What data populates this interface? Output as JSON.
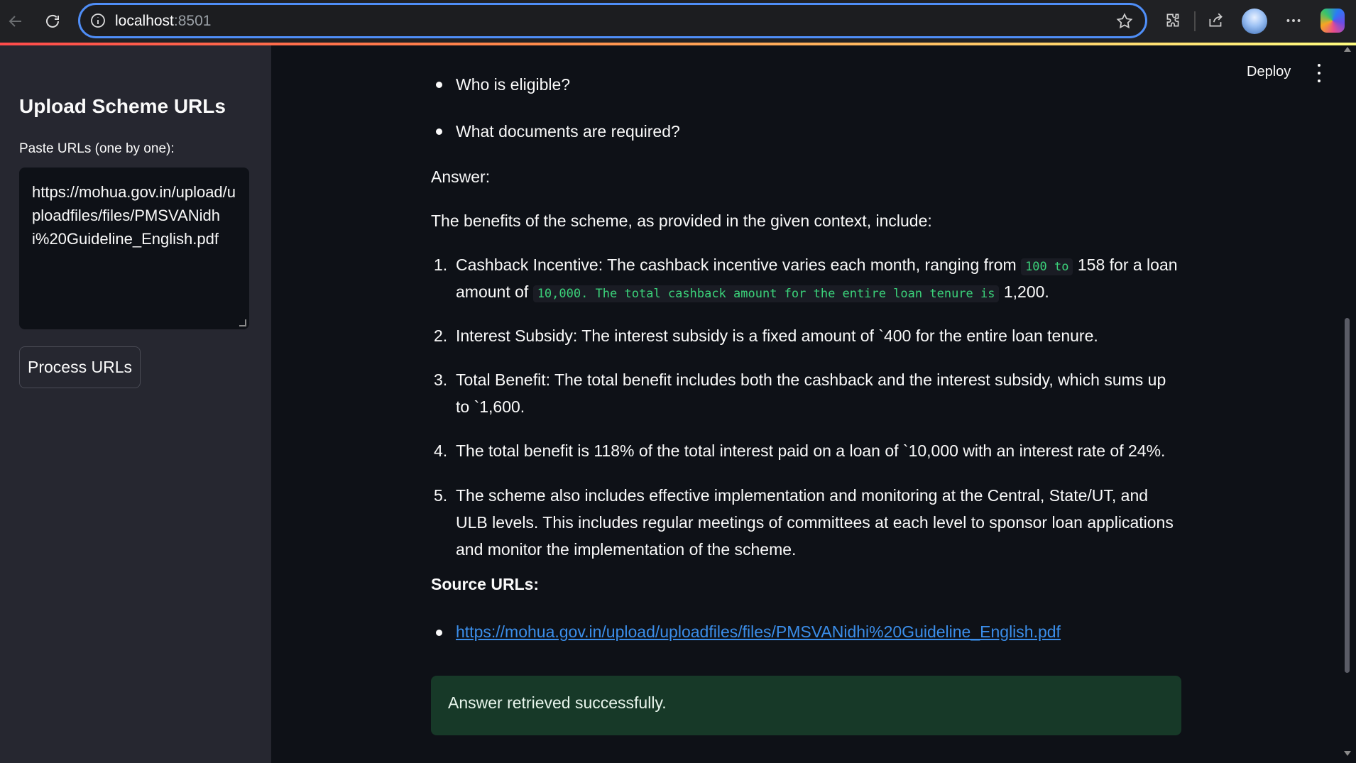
{
  "browser": {
    "url_host": "localhost",
    "url_port": ":8501"
  },
  "app": {
    "deploy_label": "Deploy"
  },
  "sidebar": {
    "title": "Upload Scheme URLs",
    "input_label": "Paste URLs (one by one):",
    "input_value": "https://mohua.gov.in/upload/uploadfiles/files/PMSVANidhi%20Guideline_English.pdf",
    "button_label": "Process URLs"
  },
  "main": {
    "question_bullets": [
      "Who is eligible?",
      "What documents are required?"
    ],
    "answer_heading": "Answer:",
    "answer_intro": "The benefits of the scheme, as provided in the given context, include:",
    "items": [
      {
        "num": "1.",
        "line1_pre": "Cashback Incentive: The cashback incentive varies each month, ranging from",
        "line1_code": "100 to",
        "line1_post": "158 for a loan",
        "line2_pre": "amount of",
        "line2_code": "10,000. The total cashback amount for the entire loan tenure is",
        "line2_post": "1,200."
      },
      {
        "num": "2.",
        "text": "Interest Subsidy: The interest subsidy is a fixed amount of `400 for the entire loan tenure."
      },
      {
        "num": "3.",
        "text": "Total Benefit: The total benefit includes both the cashback and the interest subsidy, which sums up to `1,600."
      },
      {
        "num": "4.",
        "text": "The total benefit is 118% of the total interest paid on a loan of `10,000 with an interest rate of 24%."
      },
      {
        "num": "5.",
        "text": "The scheme also includes effective implementation and monitoring at the Central, State/UT, and ULB levels. This includes regular meetings of committees at each level to sponsor loan applications and monitor the implementation of the scheme."
      }
    ],
    "sources_heading": "Source URLs:",
    "source_links": [
      "https://mohua.gov.in/upload/uploadfiles/files/PMSVANidhi%20Guideline_English.pdf"
    ],
    "success_message": "Answer retrieved successfully."
  },
  "colors": {
    "background": "#0e1117",
    "sidebar": "#262730",
    "success_bg": "#173928",
    "link": "#3b8eea",
    "code": "#3bd27a",
    "accent_border": "#4f8ef7"
  },
  "icons": [
    "back-icon",
    "reload-icon",
    "info-icon",
    "star-icon",
    "extensions-icon",
    "share-icon",
    "profile-avatar",
    "more-icon",
    "copilot-icon",
    "kebab-menu-icon"
  ]
}
